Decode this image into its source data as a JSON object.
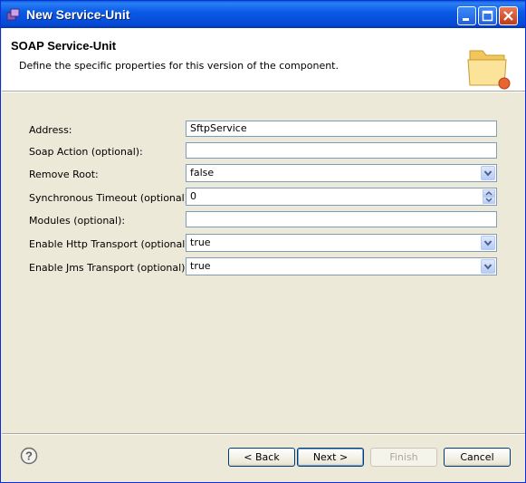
{
  "window": {
    "title": "New Service-Unit",
    "controls": {
      "minimize_icon": "minimize-icon",
      "maximize_icon": "maximize-icon",
      "close_icon": "close-icon"
    }
  },
  "header": {
    "title": "SOAP Service-Unit",
    "description": "Define the specific properties for this version of the component.",
    "icon": "folder-icon"
  },
  "form": {
    "address": {
      "label": "Address:",
      "value": "SftpService"
    },
    "soap_action": {
      "label": "Soap Action (optional):",
      "value": ""
    },
    "remove_root": {
      "label": "Remove Root:",
      "value": "false"
    },
    "sync_timeout": {
      "label": "Synchronous Timeout (optional):",
      "value": "0"
    },
    "modules": {
      "label": "Modules (optional):",
      "value": ""
    },
    "http_transport": {
      "label": "Enable Http Transport (optional):",
      "value": "true"
    },
    "jms_transport": {
      "label": "Enable Jms Transport (optional):",
      "value": "true"
    }
  },
  "footer": {
    "help_icon": "help-icon",
    "back_label": "< Back",
    "next_label": "Next >",
    "finish_label": "Finish",
    "cancel_label": "Cancel"
  },
  "colors": {
    "titlebar": "#0a5be6",
    "dialog_bg": "#ece9d8",
    "field_border": "#7f9db9",
    "close_button": "#c23a17"
  }
}
